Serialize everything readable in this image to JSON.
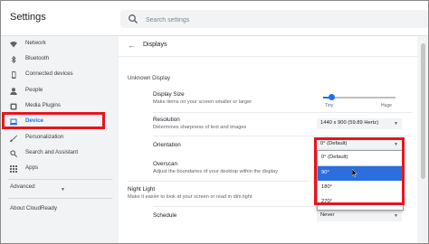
{
  "app": {
    "title": "Settings"
  },
  "search": {
    "placeholder": "Search settings"
  },
  "sidebar": {
    "items": [
      {
        "label": "Network",
        "icon": "wifi-icon"
      },
      {
        "label": "Bluetooth",
        "icon": "bluetooth-icon"
      },
      {
        "label": "Connected devices",
        "icon": "phone-icon"
      },
      {
        "label": "People",
        "icon": "person-icon"
      },
      {
        "label": "Media Plugins",
        "icon": "media-plugin-icon"
      },
      {
        "label": "Device",
        "icon": "laptop-icon",
        "selected": true
      },
      {
        "label": "Personalization",
        "icon": "brush-icon"
      },
      {
        "label": "Search and Assistant",
        "icon": "search-icon"
      },
      {
        "label": "Apps",
        "icon": "apps-grid-icon"
      }
    ],
    "advanced": "Advanced",
    "about": "About CloudReady"
  },
  "main": {
    "page_title": "Displays",
    "section": "Unknown Display",
    "display_size": {
      "title": "Display Size",
      "sub": "Make items on your screen smaller or larger",
      "min": "Tiny",
      "max": "Huge",
      "level": 0.12
    },
    "resolution": {
      "title": "Resolution",
      "sub": "Determines sharpness of text and images",
      "value": "1440 x 900 (59.89 Hertz)"
    },
    "orientation": {
      "title": "Orientation",
      "value": "0° (Default)",
      "options": [
        "0° (Default)",
        "90°",
        "180°",
        "270°"
      ],
      "highlighted": "90°"
    },
    "overscan": {
      "title": "Overscan",
      "sub": "Adjust the boundaries of your desktop within the display"
    },
    "night_light": {
      "title": "Night Light",
      "sub": "Make it easier to look at your screen or read in dim light"
    },
    "schedule": {
      "title": "Schedule",
      "value": "Never"
    }
  },
  "colors": {
    "accent": "#1a73e8",
    "highlight_box": "#e8141d",
    "menu_selected": "#2a6fdb"
  }
}
